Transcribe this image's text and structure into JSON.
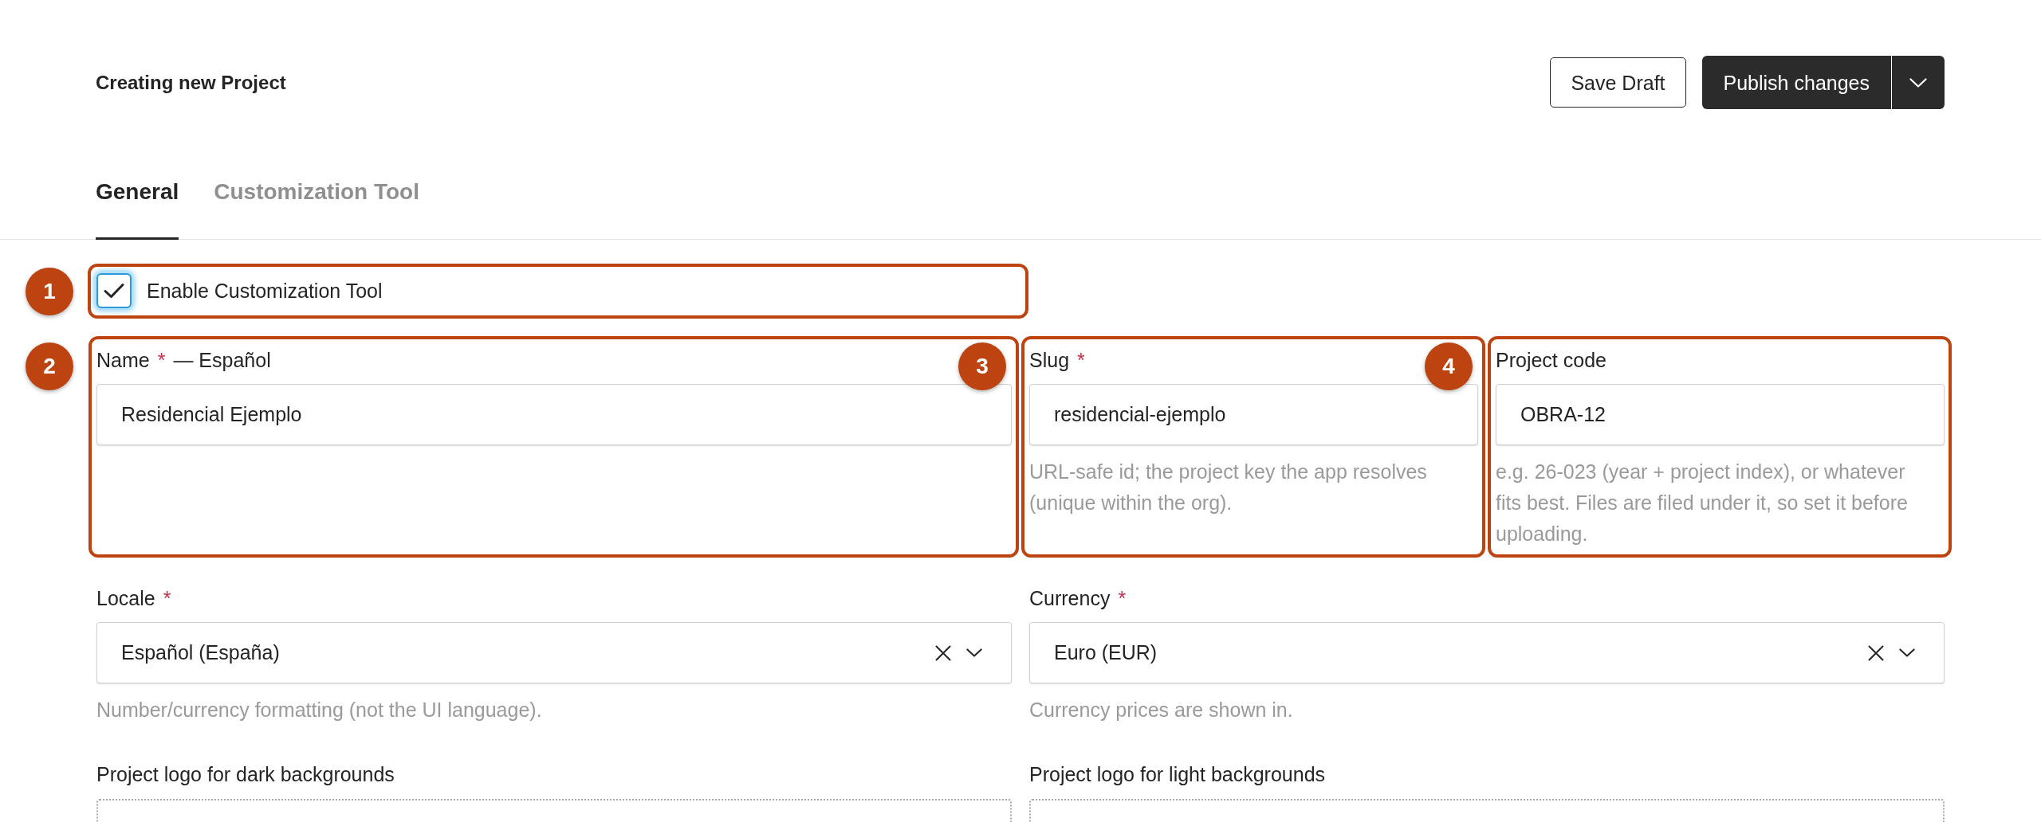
{
  "header": {
    "title": "Creating new Project",
    "actions": [
      {
        "kind": "secondary",
        "label": "Save Draft"
      },
      {
        "kind": "primary",
        "label": "Publish changes",
        "menu": true
      }
    ]
  },
  "tabs": [
    {
      "label": "General",
      "selected": true
    },
    {
      "label": "Customization Tool",
      "selected": false
    }
  ],
  "form": {
    "toggle": {
      "label": "Enable Customization Tool",
      "checked": true,
      "focused": true,
      "annotation": "1"
    },
    "rows": [
      {
        "fields": [
          {
            "kind": "text",
            "label": "Name",
            "required_mark": "*",
            "label_suffix": "— Español",
            "value": "Residencial Ejemplo",
            "annotation": "2"
          },
          {
            "kind": "text",
            "label": "Slug",
            "required_mark": "*",
            "value": "residencial-ejemplo",
            "help": "URL-safe id; the project key the app resolves (unique within the org).",
            "annotation": "3"
          },
          {
            "kind": "text",
            "label": "Project code",
            "value": "OBRA-12",
            "help": "e.g. 26-023 (year + project index), or whatever fits best. Files are filed under it, so set it before uploading.",
            "annotation": "4"
          }
        ]
      },
      {
        "fields": [
          {
            "kind": "select",
            "label": "Locale",
            "required_mark": "*",
            "value": "Español (España)",
            "clearable": true,
            "help": "Number/currency formatting (not the UI language)."
          },
          {
            "kind": "select",
            "label": "Currency",
            "required_mark": "*",
            "value": "Euro (EUR)",
            "clearable": true,
            "help": "Currency prices are shown in."
          }
        ]
      },
      {
        "fields": [
          {
            "kind": "upload",
            "label": "Project logo for dark backgrounds"
          },
          {
            "kind": "upload",
            "label": "Project logo for light backgrounds"
          }
        ]
      }
    ]
  }
}
